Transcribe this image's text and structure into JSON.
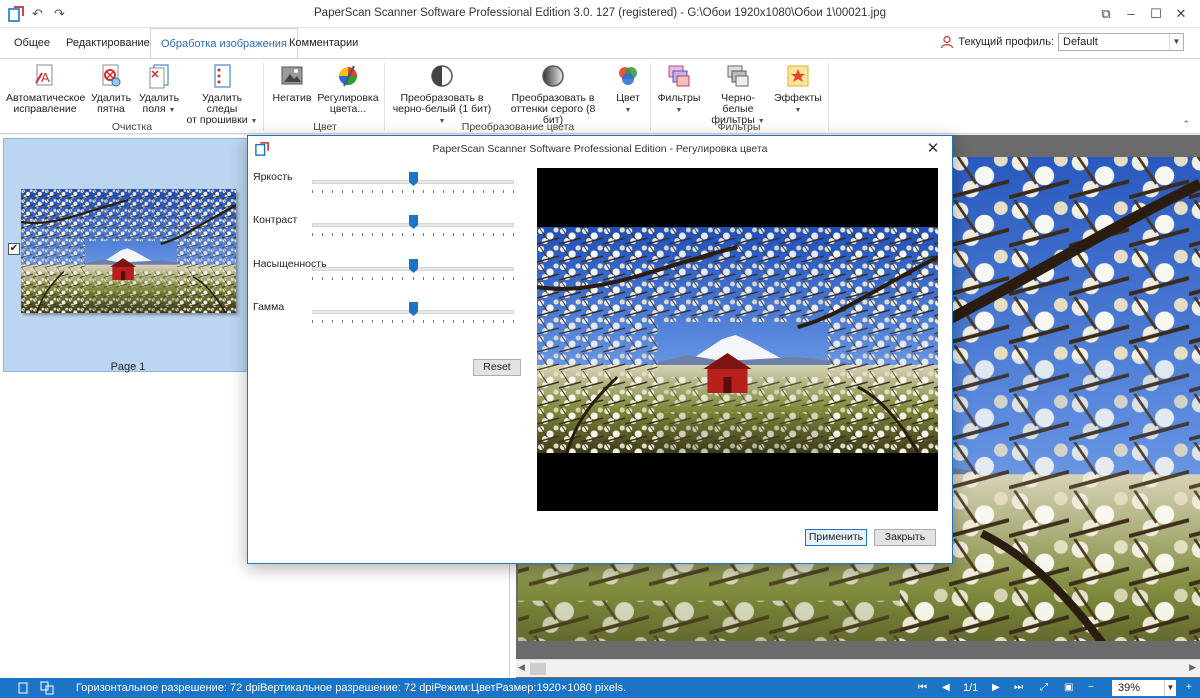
{
  "window": {
    "title": "PaperScan Scanner Software Professional Edition 3.0. 127 (registered) - G:\\Обои 1920x1080\\Обои 1\\00021.jpg"
  },
  "tabs": [
    {
      "label": "Общее"
    },
    {
      "label": "Редактирование"
    },
    {
      "label": "Обработка изображения",
      "active": true
    },
    {
      "label": "Комментарии"
    }
  ],
  "profile": {
    "label": "Текущий профиль:",
    "value": "Default"
  },
  "ribbon": {
    "groups": [
      {
        "label": "Очистка"
      },
      {
        "label": "Цвет"
      },
      {
        "label": "Преобразование цвета"
      },
      {
        "label": "Фильтры"
      }
    ],
    "buttons": [
      {
        "line1": "Автоматическое",
        "line2": "исправление",
        "icon": "auto-fix-icon"
      },
      {
        "line1": "Удалить",
        "line2": "пятна",
        "icon": "remove-spots-icon"
      },
      {
        "line1": "Удалить",
        "line2": "поля",
        "icon": "remove-margins-icon",
        "dropdown": true
      },
      {
        "line1": "Удалить следы",
        "line2": "от прошивки",
        "icon": "remove-punch-holes-icon",
        "dropdown": true
      },
      {
        "line1": "Негатив",
        "line2": "",
        "icon": "negative-icon"
      },
      {
        "line1": "Регулировка",
        "line2": "цвета...",
        "icon": "color-adjust-icon"
      },
      {
        "line1": "Преобразовать в",
        "line2": "черно-белый (1 бит)",
        "icon": "bw-convert-icon",
        "dropdown": true
      },
      {
        "line1": "Преобразовать в",
        "line2": "оттенки серого (8 бит)",
        "icon": "grayscale-convert-icon"
      },
      {
        "line1": "Цвет",
        "line2": "",
        "icon": "color-icon",
        "dropdown": true
      },
      {
        "line1": "Фильтры",
        "line2": "",
        "icon": "filters-icon",
        "dropdown": true
      },
      {
        "line1": "Черно-белые",
        "line2": "фильтры",
        "icon": "bw-filters-icon",
        "dropdown": true
      },
      {
        "line1": "Эффекты",
        "line2": "",
        "icon": "effects-icon",
        "dropdown": true
      }
    ]
  },
  "thumbnails": [
    {
      "label": "Page 1",
      "checked": true
    }
  ],
  "dialog": {
    "title": "PaperScan Scanner Software Professional Edition - Регулировка цвета",
    "sliders": [
      {
        "label": "Яркость",
        "value": 0.5
      },
      {
        "label": "Контраст",
        "value": 0.5
      },
      {
        "label": "Насыщенность",
        "value": 0.5
      },
      {
        "label": "Гамма",
        "value": 0.5
      }
    ],
    "reset_label": "Reset",
    "apply_label": "Применить",
    "close_label": "Закрыть"
  },
  "status": {
    "text": "Горизонтальное разрешение: 72 dpiВертикальное разрешение: 72 dpiРежим:ЦветРазмер:1920×1080 pixels.",
    "page": "1/1",
    "zoom": "39%"
  },
  "colors": {
    "accent": "#1c74c6",
    "statusbar": "#1c74c6",
    "thumb_selected": "#bcd6f1"
  }
}
